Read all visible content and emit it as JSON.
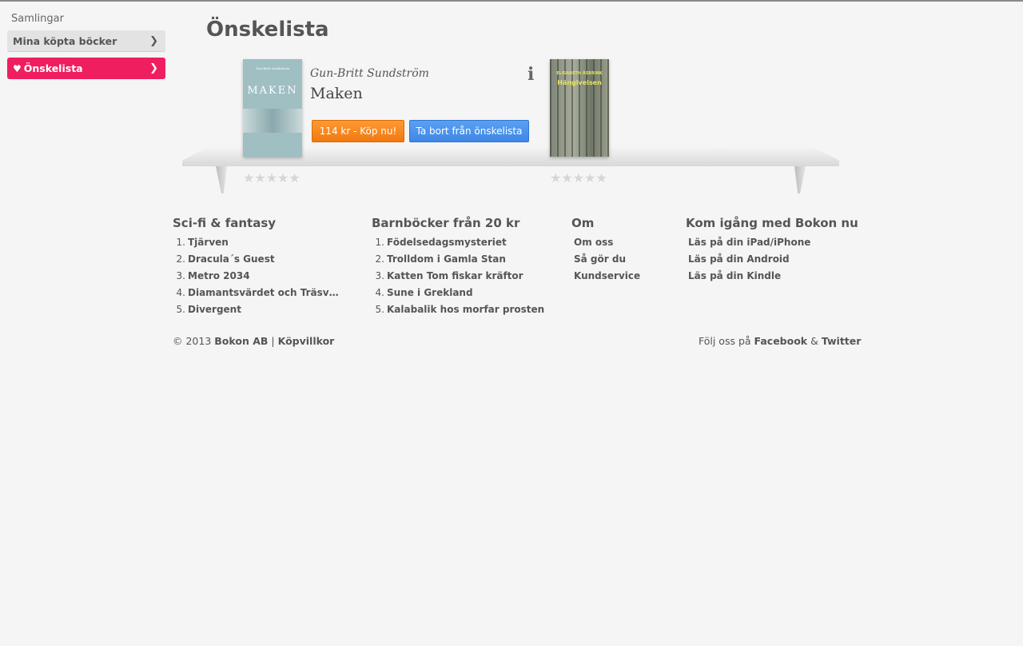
{
  "sidebar": {
    "heading": "Samlingar",
    "items": [
      {
        "label": "Mina köpta böcker"
      },
      {
        "label": "Önskelista"
      }
    ]
  },
  "page": {
    "title": "Önskelista"
  },
  "shelf": {
    "books": [
      {
        "author": "Gun-Britt Sundström",
        "title": "Maken",
        "cover_title": "MAKEN",
        "cover_small": "Gun-Britt Sundström",
        "buy_label": "114 kr - Köp nu!",
        "remove_label": "Ta bort från önskelista",
        "rating": 0
      },
      {
        "cover_author": "ELISABETH ÅSBRINK",
        "cover_title": "Hängivelsen",
        "rating": 0
      }
    ],
    "info_icon": "info-icon",
    "star_glyph": "★★★★★"
  },
  "footer": {
    "columns": [
      {
        "heading": "Sci-fi & fantasy",
        "items": [
          "Tjärven",
          "Dracula´s Guest",
          "Metro 2034",
          "Diamantsvärdet och Träsvärdet",
          "Divergent"
        ]
      },
      {
        "heading": "Barnböcker från 20 kr",
        "items": [
          "Födelsedagsmysteriet",
          "Trolldom i Gamla Stan",
          "Katten Tom fiskar kräftor",
          "Sune i Grekland",
          "Kalabalik hos morfar prosten"
        ]
      },
      {
        "heading": "Om",
        "items": [
          "Om oss",
          "Så gör du",
          "Kundservice"
        ]
      },
      {
        "heading": "Kom igång med Bokon nu",
        "items": [
          "Läs på din iPad/iPhone",
          "Läs på din Android",
          "Läs på din Kindle"
        ]
      }
    ],
    "copyright_prefix": "© 2013",
    "company": "Bokon AB",
    "separator": "|",
    "terms": "Köpvillkor",
    "follow_prefix": "Följ oss på",
    "facebook": "Facebook",
    "amp": "&",
    "twitter": "Twitter"
  },
  "colors": {
    "accent": "#ef1f5f",
    "buy": "#f07a10",
    "remove": "#3e87e6"
  }
}
